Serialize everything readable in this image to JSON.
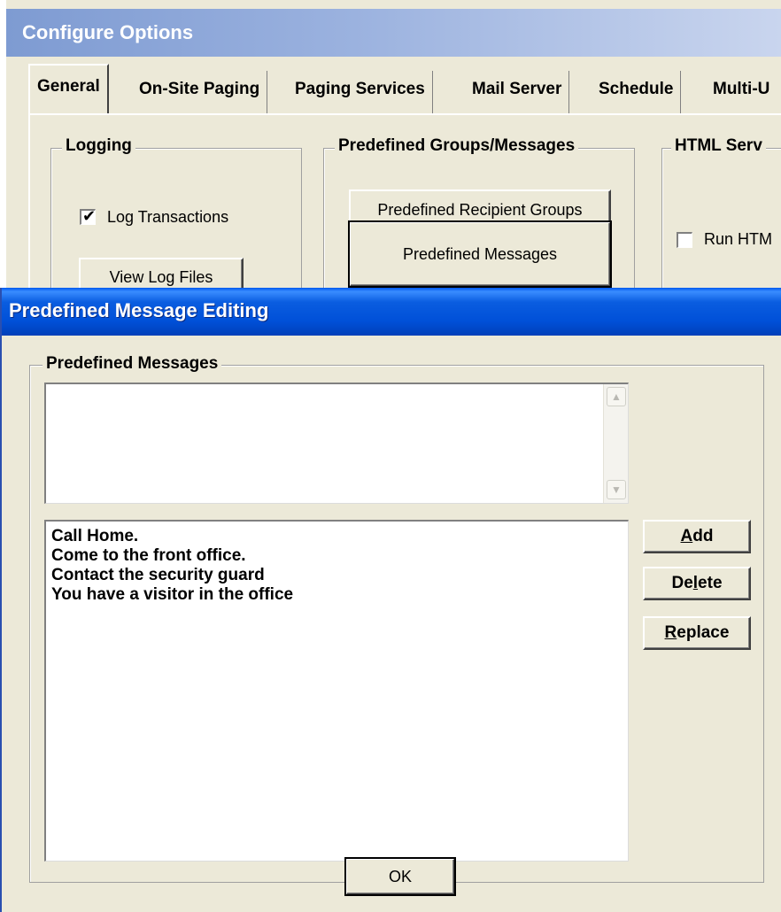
{
  "config_window": {
    "title": "Configure Options",
    "tabs": [
      {
        "label": "General",
        "active": true
      },
      {
        "label": "On-Site Paging",
        "active": false
      },
      {
        "label": "Paging Services",
        "active": false
      },
      {
        "label": "Mail Server",
        "active": false
      },
      {
        "label": "Schedule",
        "active": false
      },
      {
        "label": "Multi-U",
        "active": false
      }
    ],
    "logging": {
      "legend": "Logging",
      "log_transactions_label": "Log Transactions",
      "log_transactions_checked": true,
      "view_log_files_label": "View Log Files"
    },
    "predefined": {
      "legend": "Predefined Groups/Messages",
      "recipient_groups_label": "Predefined Recipient Groups",
      "messages_label": "Predefined Messages"
    },
    "html_server": {
      "legend": "HTML Serv",
      "run_label": "Run HTM",
      "run_checked": false
    }
  },
  "dialog": {
    "title": "Predefined Message Editing",
    "group_legend": "Predefined Messages",
    "editor_value": "",
    "messages": [
      "Call Home.",
      "Come to the front office.",
      "Contact the security guard",
      "You have a visitor in the office"
    ],
    "buttons": {
      "add": {
        "pre": "",
        "key": "A",
        "post": "dd"
      },
      "delete": {
        "pre": "De",
        "key": "l",
        "post": "ete"
      },
      "replace": {
        "pre": "",
        "key": "R",
        "post": "eplace"
      },
      "ok": "OK"
    },
    "icons": {
      "scroll_up": "up-arrow-icon",
      "scroll_down": "down-arrow-icon",
      "check": "check-mark-icon"
    }
  }
}
